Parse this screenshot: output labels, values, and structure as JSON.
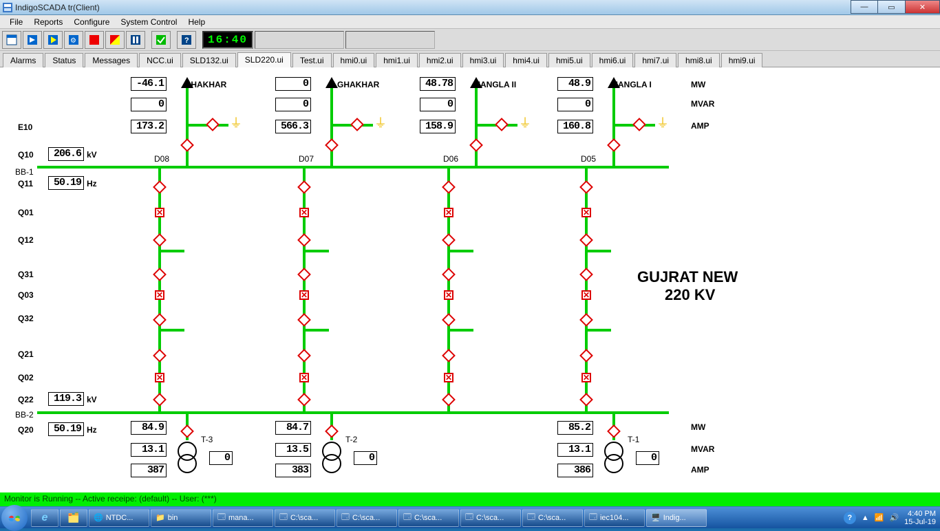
{
  "window": {
    "title": "IndigoSCADA tr(Client)"
  },
  "menu": {
    "file": "File",
    "reports": "Reports",
    "configure": "Configure",
    "system": "System Control",
    "help": "Help"
  },
  "toolbar_clock": "16:40",
  "tabs": [
    "Alarms",
    "Status",
    "Messages",
    "NCC.ui",
    "SLD132.ui",
    "SLD220.ui",
    "Test.ui",
    "hmi0.ui",
    "hmi1.ui",
    "hmi2.ui",
    "hmi3.ui",
    "hmi4.ui",
    "hmi5.ui",
    "hmi6.ui",
    "hmi7.ui",
    "hmi8.ui",
    "hmi9.ui"
  ],
  "active_tab": 5,
  "side_labels": {
    "e10": "E10",
    "q10": "Q10",
    "bb1": "BB-1",
    "q11": "Q11",
    "q01": "Q01",
    "q12": "Q12",
    "q31": "Q31",
    "q03": "Q03",
    "q32": "Q32",
    "q21": "Q21",
    "q02": "Q02",
    "q22": "Q22",
    "bb2": "BB-2",
    "q20": "Q20"
  },
  "kv1": "206.6",
  "hz1": "50.19",
  "kv2": "119.3",
  "hz2": "50.19",
  "kv_u": "kV",
  "hz_u": "Hz",
  "unit_mw": "MW",
  "unit_mvar": "MVAR",
  "unit_amp": "AMP",
  "station": {
    "name": "GUJRAT NEW",
    "volt": "220 KV"
  },
  "feeders": [
    {
      "id": "D08",
      "name": "GHAKHAR",
      "mw": "-46.1",
      "mvar": "0",
      "amp": "173.2"
    },
    {
      "id": "D07",
      "name": "N GHAKHAR",
      "mw": "0",
      "mvar": "0",
      "amp": "566.3"
    },
    {
      "id": "D06",
      "name": "MANGLA II",
      "mw": "48.78",
      "mvar": "0",
      "amp": "158.9"
    },
    {
      "id": "D05",
      "name": "MANGLA I",
      "mw": "48.9",
      "mvar": "0",
      "amp": "160.8"
    }
  ],
  "txf": [
    {
      "name": "T-3",
      "mw": "84.9",
      "mvar": "13.1",
      "amp": "387",
      "extra": "0"
    },
    {
      "name": "T-2",
      "mw": "84.7",
      "mvar": "13.5",
      "amp": "383",
      "extra": "0"
    },
    {
      "name": "T-1",
      "mw": "85.2",
      "mvar": "13.1",
      "amp": "386",
      "extra": "0"
    }
  ],
  "status": "Monitor is Running -- Active receipe: (default) -- User: (***)",
  "task": {
    "items": [
      "NTDC...",
      "bin",
      "mana...",
      "C:\\sca...",
      "C:\\sca...",
      "C:\\sca...",
      "C:\\sca...",
      "C:\\sca...",
      "iec104...",
      "Indig..."
    ],
    "time": "4:40 PM",
    "date": "15-Jul-19"
  }
}
